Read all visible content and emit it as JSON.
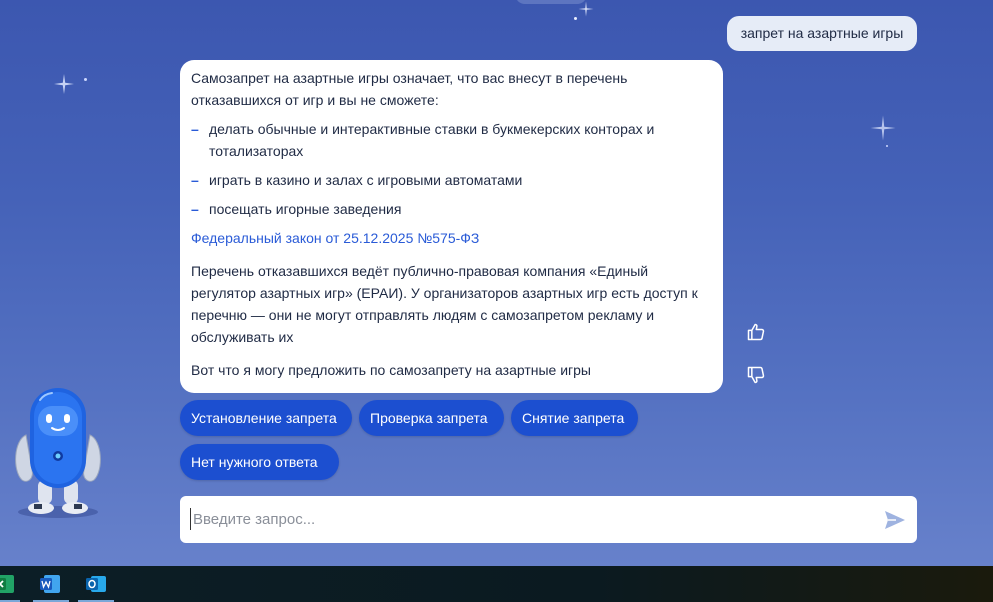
{
  "chat": {
    "user_message": "запрет на азартные игры",
    "bot_intro": "Самозапрет на азартные игры означает, что вас внесут в перечень отказавшихся от игр и вы не сможете:",
    "bot_bullets": [
      "делать обычные и интерактивные ставки в букмекерских конторах и тотализаторах",
      "играть в казино и залах с игровыми автоматами",
      "посещать игорные заведения"
    ],
    "law_link": "Федеральный закон от 25.12.2025 №575-ФЗ",
    "bot_registry": "Перечень отказавшихся ведёт публично-правовая компания «Единый регулятор азартных игр» (ЕРАИ). У организаторов азартных игр есть доступ к перечню — они не могут отправлять людям с самозапретом рекламу и обслуживать их",
    "bot_offer": "Вот что я могу предложить по самозапрету на азартные игры"
  },
  "quick_replies": [
    "Установление запрета",
    "Проверка запрета",
    "Снятие запрета",
    "Нет нужного ответа"
  ],
  "input": {
    "placeholder": "Введите запрос..."
  },
  "colors": {
    "accent": "#1c4fd0",
    "link": "#2a5bd7",
    "background": "#4562b8"
  },
  "icons": {
    "like": "thumbs-up-icon",
    "dislike": "thumbs-down-icon",
    "send": "send-icon",
    "taskbar": [
      "excel-icon",
      "word-icon",
      "outlook-icon"
    ]
  }
}
